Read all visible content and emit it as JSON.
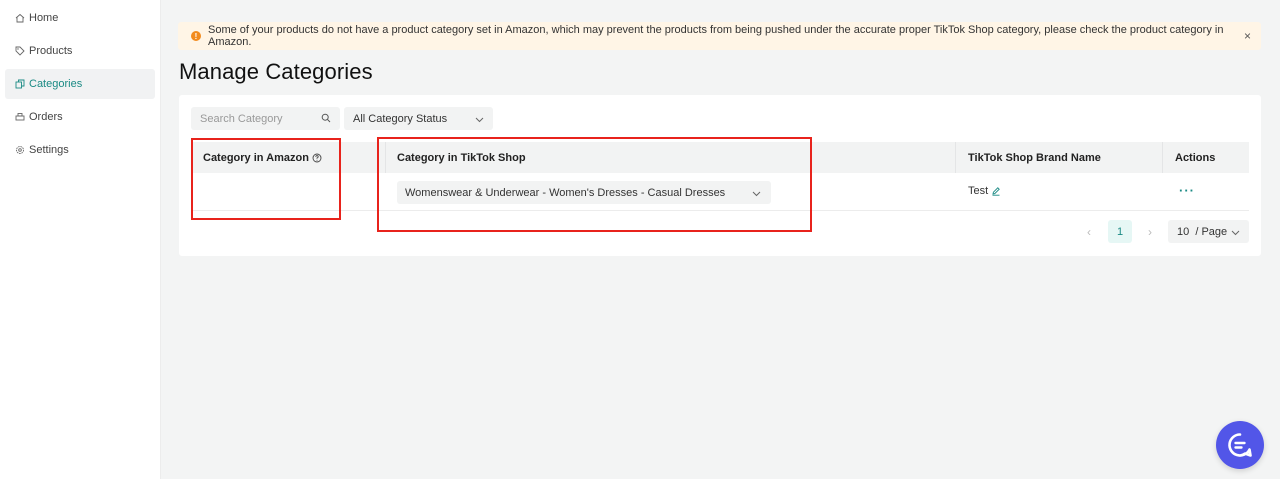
{
  "sidebar": {
    "items": [
      {
        "label": "Home",
        "icon": "home-icon",
        "active": false
      },
      {
        "label": "Products",
        "icon": "tag-icon",
        "active": false
      },
      {
        "label": "Categories",
        "icon": "copy-icon",
        "active": true
      },
      {
        "label": "Orders",
        "icon": "printer-icon",
        "active": false
      },
      {
        "label": "Settings",
        "icon": "gear-icon",
        "active": false
      }
    ]
  },
  "banner": {
    "message": "Some of your products do not have a product category set in Amazon, which may prevent the products from being pushed under the accurate proper TikTok Shop category, please check the product category in Amazon.",
    "close": "×",
    "icon": "!"
  },
  "page": {
    "title": "Manage Categories"
  },
  "filters": {
    "search_placeholder": "Search Category",
    "status_select": "All Category Status"
  },
  "table": {
    "columns": [
      "Category in Amazon",
      "Category in TikTok Shop",
      "TikTok Shop Brand Name",
      "Actions"
    ],
    "rows": [
      {
        "amazon_category": "",
        "tiktok_category": "Womenswear & Underwear - Women's Dresses - Casual Dresses",
        "brand": "Test",
        "actions": "···"
      }
    ]
  },
  "pagination": {
    "prev": "‹",
    "current": "1",
    "next": "›",
    "page_size": "10  / Page"
  },
  "colors": {
    "accent": "#1a8a84",
    "warning": "#f28a1c",
    "highlight": "#e8231c",
    "chat": "#5256e8"
  }
}
